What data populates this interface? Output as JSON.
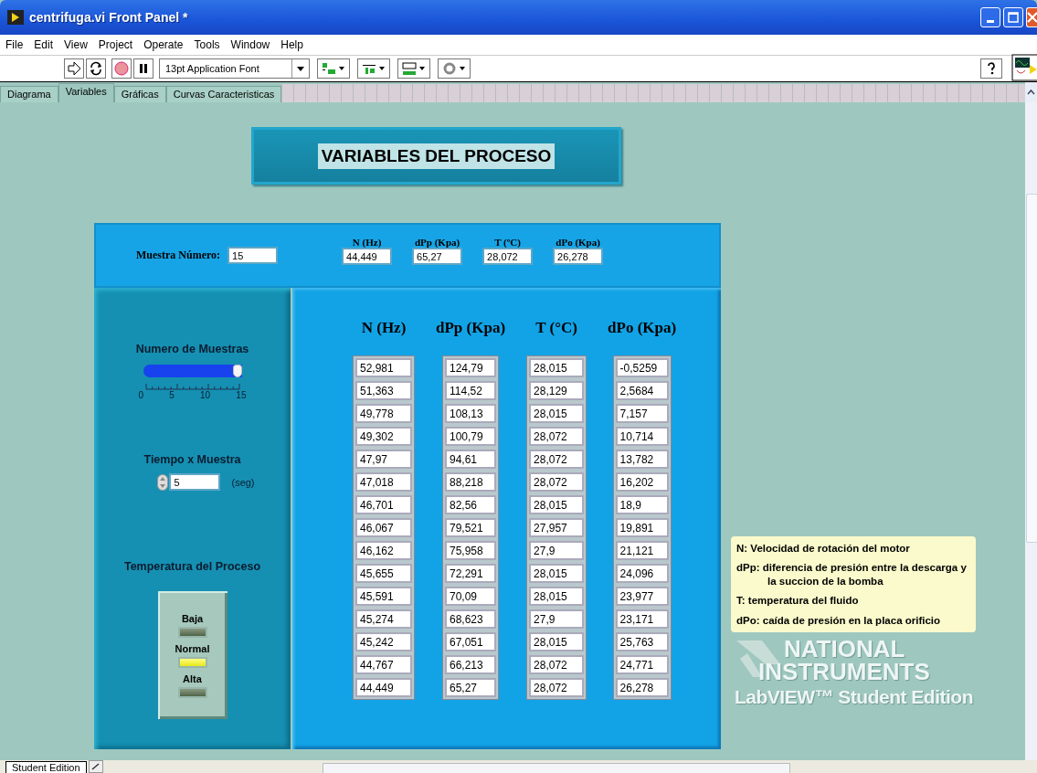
{
  "window": {
    "title": "centrifuga.vi Front Panel *"
  },
  "menu": [
    "File",
    "Edit",
    "View",
    "Project",
    "Operate",
    "Tools",
    "Window",
    "Help"
  ],
  "toolbar": {
    "font": "13pt Application Font"
  },
  "tabs": [
    {
      "label": "Diagrama",
      "selected": false
    },
    {
      "label": "Variables",
      "selected": true
    },
    {
      "label": "Gráficas",
      "selected": false
    },
    {
      "label": "Curvas Caracteristicas",
      "selected": false
    }
  ],
  "panel_title": "VARIABLES DEL PROCESO",
  "current": {
    "label": "Muestra Número:",
    "value": "15",
    "readings": [
      {
        "label": "N (Hz)",
        "value": "44,449"
      },
      {
        "label": "dPp (Kpa)",
        "value": "65,27"
      },
      {
        "label": "T (ºC)",
        "value": "28,072"
      },
      {
        "label": "dPo (Kpa)",
        "value": "26,278"
      }
    ]
  },
  "samples": {
    "label": "Numero de Muestras",
    "level": 1,
    "ticks": [
      "0",
      "5",
      "10",
      "15"
    ]
  },
  "time": {
    "label": "Tiempo x Muestra",
    "value": "5",
    "unit": "(seg)"
  },
  "temperature": {
    "label": "Temperatura del Proceso",
    "leds": [
      {
        "label": "Baja",
        "on": false
      },
      {
        "label": "Normal",
        "on": true
      },
      {
        "label": "Alta",
        "on": false
      }
    ]
  },
  "table": {
    "columns": [
      "N (Hz)",
      "dPp (Kpa)",
      "T (°C)",
      "dPo (Kpa)"
    ],
    "rows": [
      [
        "52,981",
        "124,79",
        "28,015",
        "-0,5259"
      ],
      [
        "51,363",
        "114,52",
        "28,129",
        "2,5684"
      ],
      [
        "49,778",
        "108,13",
        "28,015",
        "7,157"
      ],
      [
        "49,302",
        "100,79",
        "28,072",
        "10,714"
      ],
      [
        "47,97",
        "94,61",
        "28,072",
        "13,782"
      ],
      [
        "47,018",
        "88,218",
        "28,072",
        "16,202"
      ],
      [
        "46,701",
        "82,56",
        "28,015",
        "18,9"
      ],
      [
        "46,067",
        "79,521",
        "27,957",
        "19,891"
      ],
      [
        "46,162",
        "75,958",
        "27,9",
        "21,121"
      ],
      [
        "45,655",
        "72,291",
        "28,015",
        "24,096"
      ],
      [
        "45,591",
        "70,09",
        "28,015",
        "23,977"
      ],
      [
        "45,274",
        "68,623",
        "27,9",
        "23,171"
      ],
      [
        "45,242",
        "67,051",
        "28,015",
        "25,763"
      ],
      [
        "44,767",
        "66,213",
        "28,072",
        "24,771"
      ],
      [
        "44,449",
        "65,27",
        "28,072",
        "26,278"
      ]
    ]
  },
  "legend": [
    {
      "term": "N:",
      "text": "Velocidad de rotación del motor"
    },
    {
      "term": "dPp:",
      "text": "diferencia de presión entre la descarga y la succion de la bomba"
    },
    {
      "term": "T:",
      "text": "temperatura del fluido"
    },
    {
      "term": "dPo:",
      "text": "caída de presión en la placa orificio"
    }
  ],
  "branding": [
    "NATIONAL",
    "INSTRUMENTS",
    "LabVIEW™ Student Edition"
  ],
  "status_tab": "Student Edition"
}
